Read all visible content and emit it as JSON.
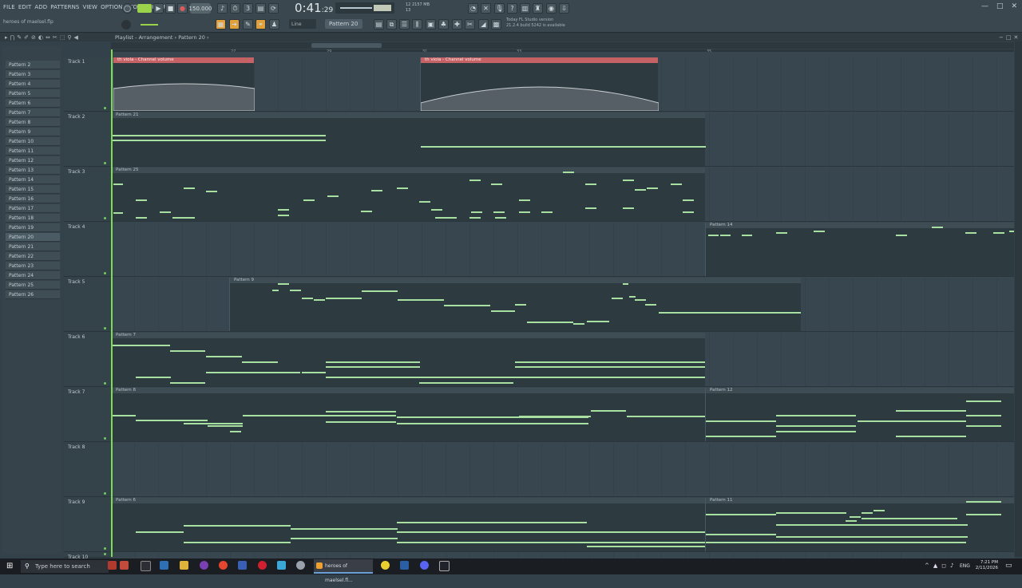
{
  "menu": [
    "FILE",
    "EDIT",
    "ADD",
    "PATTERNS",
    "VIEW",
    "OPTIONS",
    "TOOLS",
    "HELP"
  ],
  "filename": "heroes of maelsel.flp",
  "tempo": "150.000",
  "time": {
    "main": "0:41",
    "sub": ":29"
  },
  "cpu": {
    "line1": "12   2157 MB",
    "line2": "13"
  },
  "snap": "Line",
  "pattern_selector": "Pattern 20",
  "news": {
    "line1": "Today  FL Studio version",
    "line2": "21.2.4 build 5242 is available"
  },
  "breadcrumb": "Playlist - Arrangement  ›  Pattern 20 ›",
  "ruler_marks": [
    "27",
    "29",
    "31",
    "33",
    "35"
  ],
  "patterns": [
    "Pattern 2",
    "Pattern 3",
    "Pattern 4",
    "Pattern 5",
    "Pattern 6",
    "Pattern 7",
    "Pattern 8",
    "Pattern 9",
    "Pattern 10",
    "Pattern 11",
    "Pattern 12",
    "Pattern 13",
    "Pattern 14",
    "Pattern 15",
    "Pattern 16",
    "Pattern 17",
    "Pattern 18",
    "Pattern 19",
    "Pattern 20",
    "Pattern 21",
    "Pattern 22",
    "Pattern 23",
    "Pattern 24",
    "Pattern 25",
    "Pattern 26"
  ],
  "tracks": [
    "Track 1",
    "Track 2",
    "Track 3",
    "Track 4",
    "Track 5",
    "Track 6",
    "Track 7",
    "Track 8",
    "Track 9",
    "Track 10"
  ],
  "clips": {
    "t1a": "th viola - Channel volume",
    "t1b": "th viola - Channel volume",
    "t2": "Pattern 21",
    "t3": "Pattern 25",
    "t4": "Pattern 14",
    "t5": "Pattern 9",
    "t6": "Pattern 7",
    "t7a": "Pattern 8",
    "t7b": "Pattern 12",
    "t9a": "Pattern 6",
    "t9b": "Pattern 11"
  },
  "taskbar": {
    "search_placeholder": "Type here to search",
    "active_app": "heroes of maelsel.fl...",
    "lang": "ENG",
    "time": "7:21 PM",
    "date": "2/11/2026"
  },
  "colors": {
    "accent": "#7ddc55",
    "note": "#a8e0a2",
    "automation": "#c46266"
  }
}
